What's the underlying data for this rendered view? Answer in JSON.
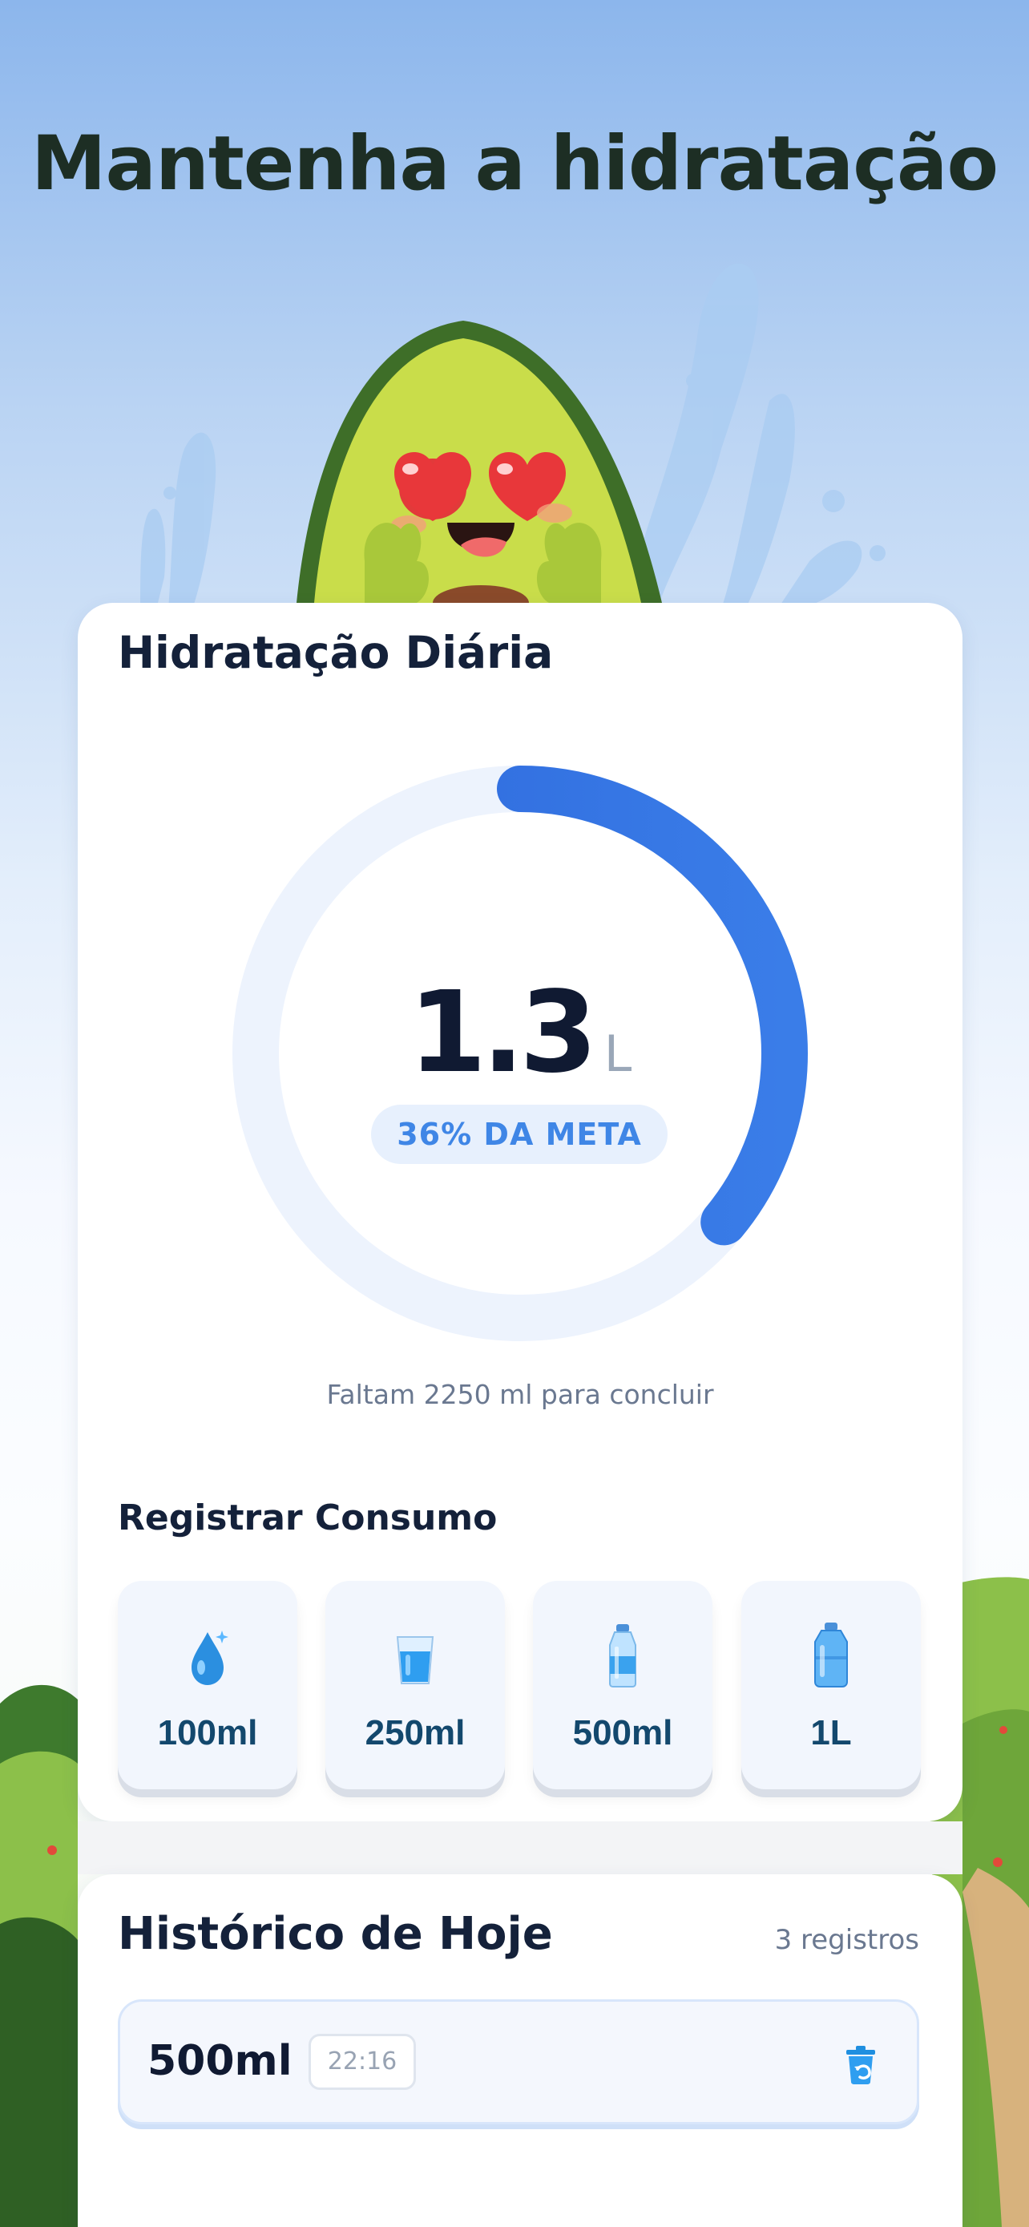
{
  "headline": "Mantenha a hidratação",
  "daily": {
    "title": "Hidratação Diária",
    "value": "1.3",
    "unit": "L",
    "progress_fraction": 0.36,
    "goal_text": "36% DA META",
    "remaining_text": "Faltam 2250 ml para concluir"
  },
  "register": {
    "title": "Registrar Consumo",
    "options": [
      {
        "label": "100ml",
        "icon": "water-drop-icon"
      },
      {
        "label": "250ml",
        "icon": "water-glass-icon"
      },
      {
        "label": "500ml",
        "icon": "water-bottle-icon"
      },
      {
        "label": "1L",
        "icon": "water-jug-icon"
      }
    ]
  },
  "history": {
    "title": "Histórico de Hoje",
    "count_text": "3 registros",
    "entries": [
      {
        "amount": "500ml",
        "time": "22:16",
        "action_icon": "undo-trash-icon"
      }
    ]
  },
  "colors": {
    "accent": "#2f6fe0",
    "ring_track": "#edf3fd",
    "heading": "#14213a",
    "tile_label": "#13486d"
  }
}
